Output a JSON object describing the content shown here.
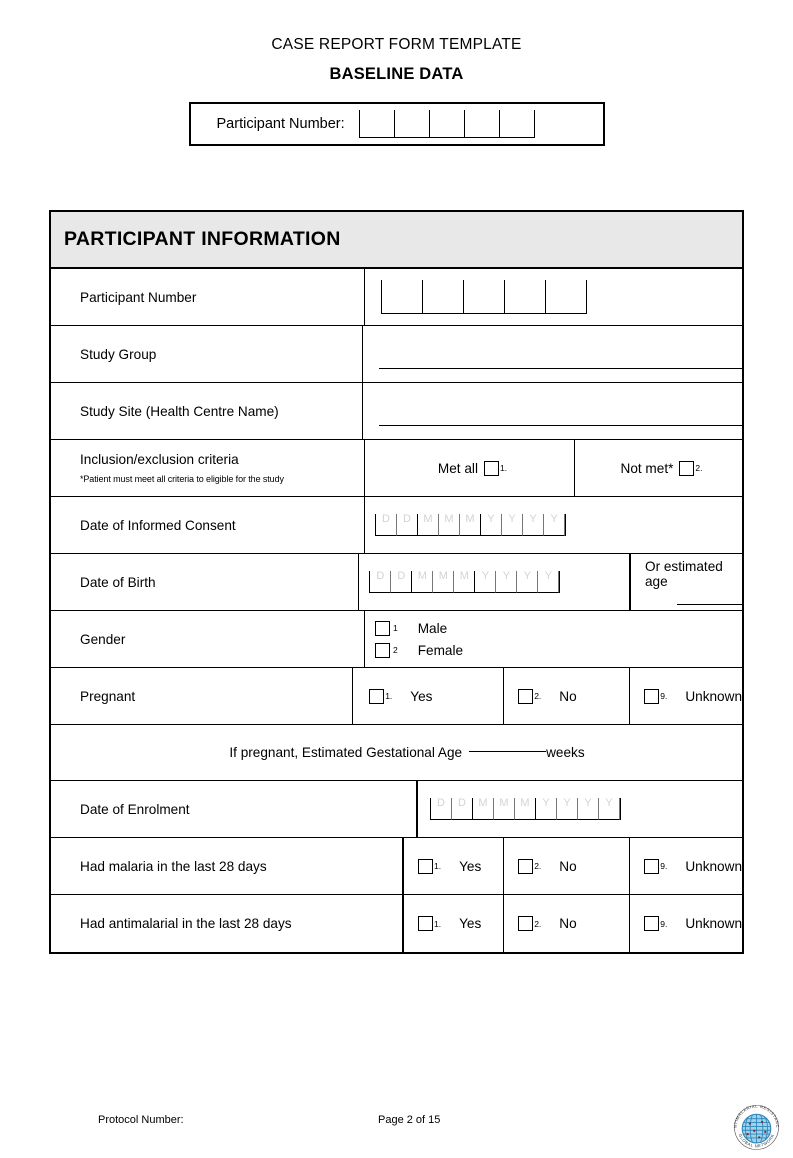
{
  "header": {
    "title": "CASE REPORT FORM TEMPLATE",
    "subtitle": "BASELINE DATA",
    "participant_number_label": "Participant Number:",
    "participant_number_boxes": 5,
    "participant_number_value": ""
  },
  "section": {
    "title": "PARTICIPANT INFORMATION"
  },
  "rows": {
    "participant_number": {
      "label": "Participant Number",
      "boxes": 5,
      "value": ""
    },
    "study_group": {
      "label": "Study Group",
      "value": ""
    },
    "study_site": {
      "label": "Study Site (Health Centre Name)",
      "value": ""
    },
    "criteria": {
      "label": "Inclusion/exclusion criteria",
      "note": "*Patient must meet all criteria to eligible for the study",
      "option_met": "Met all",
      "option_met_code": "1.",
      "option_not_met": "Not met*",
      "option_not_met_code": "2."
    },
    "date_consent": {
      "label": "Date of Informed Consent"
    },
    "date_birth": {
      "label": "Date of Birth",
      "estimated_age_label": "Or estimated age",
      "estimated_age_value": ""
    },
    "gender": {
      "label": "Gender",
      "option_male": "Male",
      "option_male_code": "1",
      "option_female": "Female",
      "option_female_code": "2"
    },
    "pregnant": {
      "label": "Pregnant",
      "yes": "Yes",
      "yes_code": "1.",
      "no": "No",
      "no_code": "2.",
      "unknown": "Unknown",
      "unknown_code": "9."
    },
    "gestational_age": {
      "prefix": "If pregnant, Estimated Gestational Age",
      "value": "",
      "suffix": "weeks"
    },
    "date_enrolment": {
      "label": "Date of Enrolment"
    },
    "malaria_28": {
      "label": "Had malaria in the last 28 days",
      "yes": "Yes",
      "yes_code": "1.",
      "no": "No",
      "no_code": "2.",
      "unknown": "Unknown",
      "unknown_code": "9."
    },
    "antimalarial_28": {
      "label": "Had antimalarial in the last 28 days",
      "yes": "Yes",
      "yes_code": "1.",
      "no": "No",
      "no_code": "2.",
      "unknown": "Unknown",
      "unknown_code": "9."
    }
  },
  "date_format": {
    "day": [
      "D",
      "D"
    ],
    "month": [
      "M",
      "M",
      "M"
    ],
    "year": [
      "Y",
      "Y",
      "Y",
      "Y"
    ]
  },
  "footer": {
    "protocol_label": "Protocol Number:",
    "page_label": "Page 2 of 15",
    "logo_name": "globe-logo"
  },
  "colors": {
    "section_header_bg": "#e8e8e8",
    "rule": "#000000",
    "date_hint": "#d3d3d3",
    "logo_blue": "#3a9fd0",
    "logo_dot": "#8c2638"
  }
}
